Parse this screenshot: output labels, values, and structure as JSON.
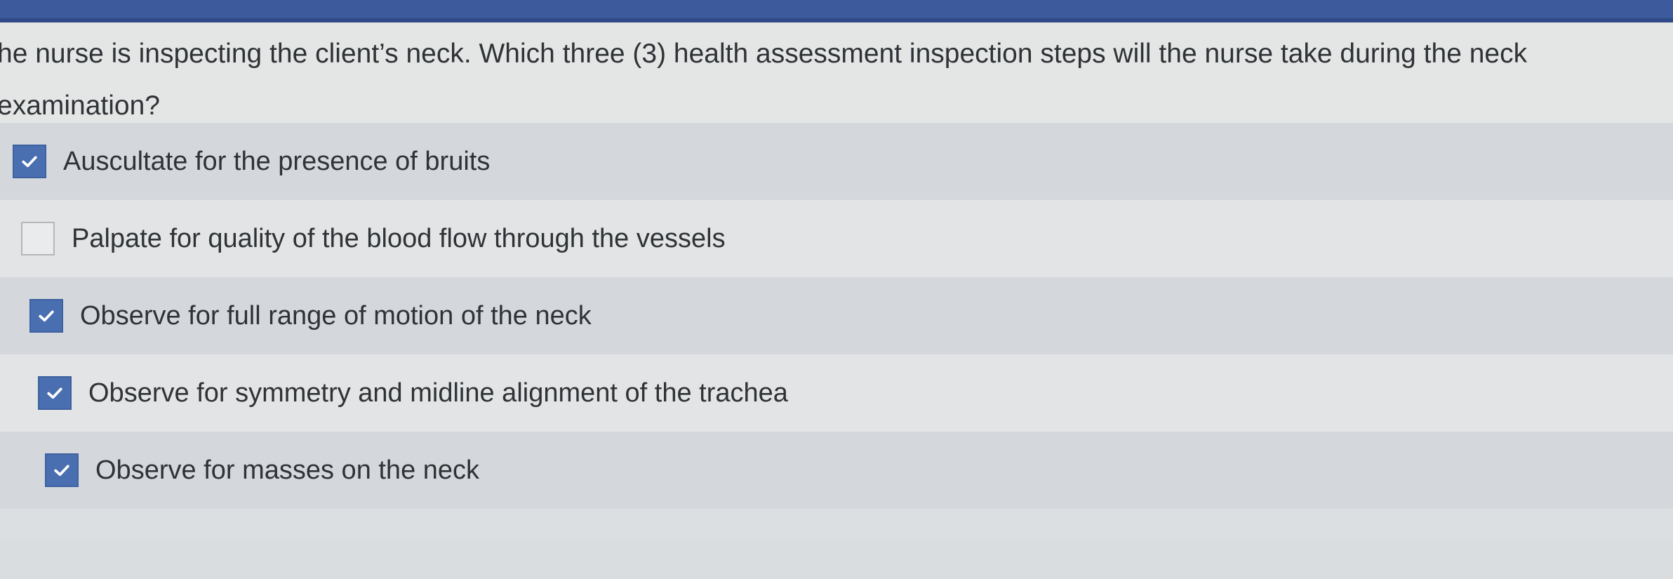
{
  "question": {
    "text": "he nurse is inspecting the client’s neck. Which three (3) health assessment inspection steps will the nurse take during the neck examination?"
  },
  "options": [
    {
      "label": "Auscultate for the presence of bruits",
      "checked": true
    },
    {
      "label": "Palpate for quality of the blood flow through the vessels",
      "checked": false
    },
    {
      "label": "Observe for full range of motion of the neck",
      "checked": true
    },
    {
      "label": "Observe for symmetry and midline alignment of the trachea",
      "checked": true
    },
    {
      "label": "Observe for masses on the neck",
      "checked": true
    }
  ],
  "colors": {
    "banner": "#3d5a9c",
    "checkbox_checked": "#4a6fb0",
    "text": "#2f3336"
  }
}
